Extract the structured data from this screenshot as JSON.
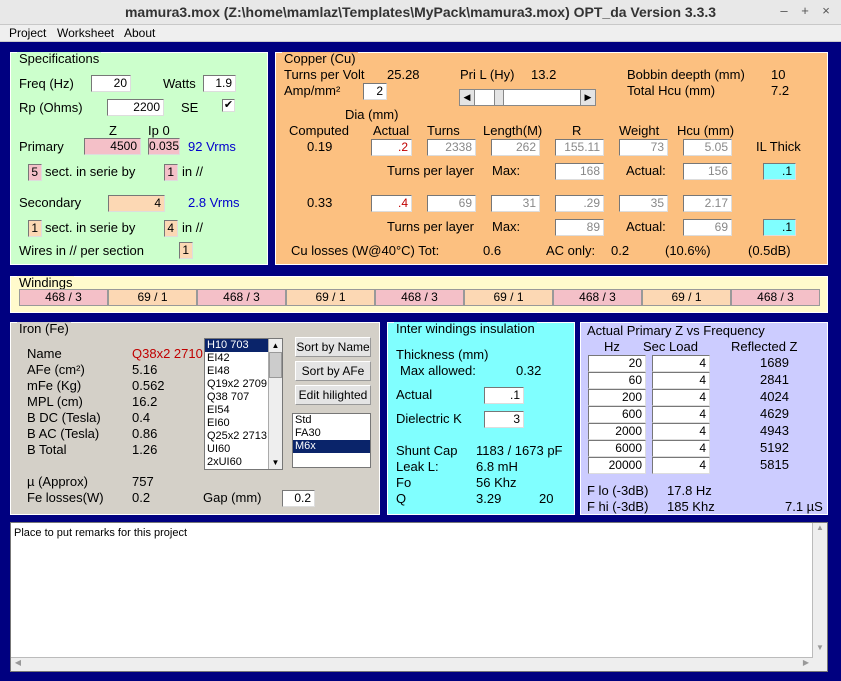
{
  "window": {
    "title": "mamura3.mox  (Z:\\home\\mamlaz\\Templates\\MyPack\\mamura3.mox)  OPT_da Version 3.3.3",
    "minimize": "–",
    "maximize": "+",
    "close": "×"
  },
  "menu": [
    "Project",
    "Worksheet",
    "About"
  ],
  "spec": {
    "legend": "Specifications",
    "freq_label": "Freq (Hz)",
    "freq": "20",
    "watts_label": "Watts",
    "watts": "1.9",
    "rp_label": "Rp (Ohms)",
    "rp": "2200",
    "se_label": "SE",
    "se_check": "✔",
    "z_label": "Z",
    "ip0_label": "Ip 0",
    "primary_label": "Primary",
    "primary_z": "4500",
    "primary_ip0": "0.035",
    "primary_vrms": "92 Vrms",
    "p_sect": "5",
    "sect_label": "sect. in serie by",
    "p_in": "1",
    "in_label": "in //",
    "secondary_label": "Secondary",
    "secondary_z": "4",
    "secondary_vrms": "2.8 Vrms",
    "s_sect": "1",
    "s_in": "4",
    "wires_label": "Wires in // per section",
    "wires": "1"
  },
  "copper": {
    "legend": "Copper (Cu)",
    "tpv_label": "Turns per Volt",
    "tpv": "25.28",
    "pril_label": "Pri L (Hy)",
    "pril": "13.2",
    "bobbin_label": "Bobbin deepth (mm)",
    "bobbin": "10",
    "amp_label": "Amp/mm²",
    "amp": "2",
    "hcu_label": "Total Hcu (mm)",
    "hcu": "7.2",
    "dia_label": "Dia (mm)",
    "computed_label": "Computed",
    "actual_label": "Actual",
    "turns_label": "Turns",
    "length_label": "Length(M)",
    "r_label": "R",
    "weight_label": "Weight",
    "hcumm_label": "Hcu (mm)",
    "il_label": "IL Thick",
    "p_computed": "0.19",
    "p_actual": ".2",
    "p_turns": "2338",
    "p_length": "262",
    "p_r": "155.11",
    "p_weight": "73",
    "p_hcu": "5.05",
    "tpl_label": "Turns per layer",
    "max_label": "Max:",
    "act_label": "Actual:",
    "p_max": "168",
    "p_act": "156",
    "p_il": ".1",
    "s_computed": "0.33",
    "s_actual": ".4",
    "s_turns": "69",
    "s_length": "31",
    "s_r": ".29",
    "s_weight": "35",
    "s_hcu": "2.17",
    "s_max": "89",
    "s_act": "69",
    "s_il": ".1",
    "loss_label": "Cu losses (W@40°C) Tot:",
    "loss_tot": "0.6",
    "ac_label": "AC only:",
    "ac": "0.2",
    "pct": "(10.6%)",
    "db": "(0.5dB)"
  },
  "windings": {
    "legend": "Windings",
    "cells": [
      "468 / 3",
      "69 / 1",
      "468 / 3",
      "69 / 1",
      "468 / 3",
      "69 / 1",
      "468 / 3",
      "69 / 1",
      "468 / 3"
    ]
  },
  "iron": {
    "legend": "Iron (Fe)",
    "name_label": "Name",
    "name": "Q38x2  2710",
    "afe_label": "AFe (cm²)",
    "afe": "5.16",
    "mfe_label": "mFe (Kg)",
    "mfe": "0.562",
    "mpl_label": "MPL (cm)",
    "mpl": "16.2",
    "bdc_label": "B DC (Tesla)",
    "bdc": "0.4",
    "bac_label": "B AC (Tesla)",
    "bac": "0.86",
    "bt_label": "B Total",
    "bt": "1.26",
    "mu_label": "µ (Approx)",
    "mu": "757",
    "fel_label": "Fe losses(W)",
    "fel": "0.2",
    "gap_label": "Gap (mm)",
    "gap": "0.2",
    "cores": [
      "H10  703",
      "EI42",
      "EI48",
      "Q19x2  2709",
      "Q38  707",
      "EI54",
      "EI60",
      "Q25x2  2713",
      "UI60",
      "2xUI60"
    ],
    "sort_name": "Sort by Name",
    "sort_afe": "Sort by AFe",
    "edit": "Edit hilighted",
    "types": [
      "Std",
      "FA30",
      "M6x"
    ]
  },
  "ins": {
    "legend": "Inter windings insulation",
    "thick_label": "Thickness (mm)",
    "max_label": "Max allowed:",
    "max": "0.32",
    "actual_label": "Actual",
    "actual": ".1",
    "dk_label": "Dielectric K",
    "dk": "3",
    "shunt_label": "Shunt Cap",
    "shunt": "1183 / 1673 pF",
    "leak_label": "Leak L:",
    "leak": "6.8 mH",
    "fo_label": "Fo",
    "fo": "56 Khz",
    "q_label": "Q",
    "q": "3.29",
    "q2": "20"
  },
  "zf": {
    "legend": "Actual Primary Z vs Frequency",
    "hz_label": "Hz",
    "sec_label": "Sec Load",
    "refl_label": "Reflected Z",
    "rows": [
      {
        "hz": "20",
        "load": "4",
        "z": "1689"
      },
      {
        "hz": "60",
        "load": "4",
        "z": "2841"
      },
      {
        "hz": "200",
        "load": "4",
        "z": "4024"
      },
      {
        "hz": "600",
        "load": "4",
        "z": "4629"
      },
      {
        "hz": "2000",
        "load": "4",
        "z": "4943"
      },
      {
        "hz": "6000",
        "load": "4",
        "z": "5192"
      },
      {
        "hz": "20000",
        "load": "4",
        "z": "5815"
      }
    ],
    "flo_label": "F lo (-3dB)",
    "flo": "17.8 Hz",
    "fhi_label": "F hi (-3dB)",
    "fhi": "185 Khz",
    "us": "7.1 µS"
  },
  "remarks": "Place to put remarks for this project"
}
